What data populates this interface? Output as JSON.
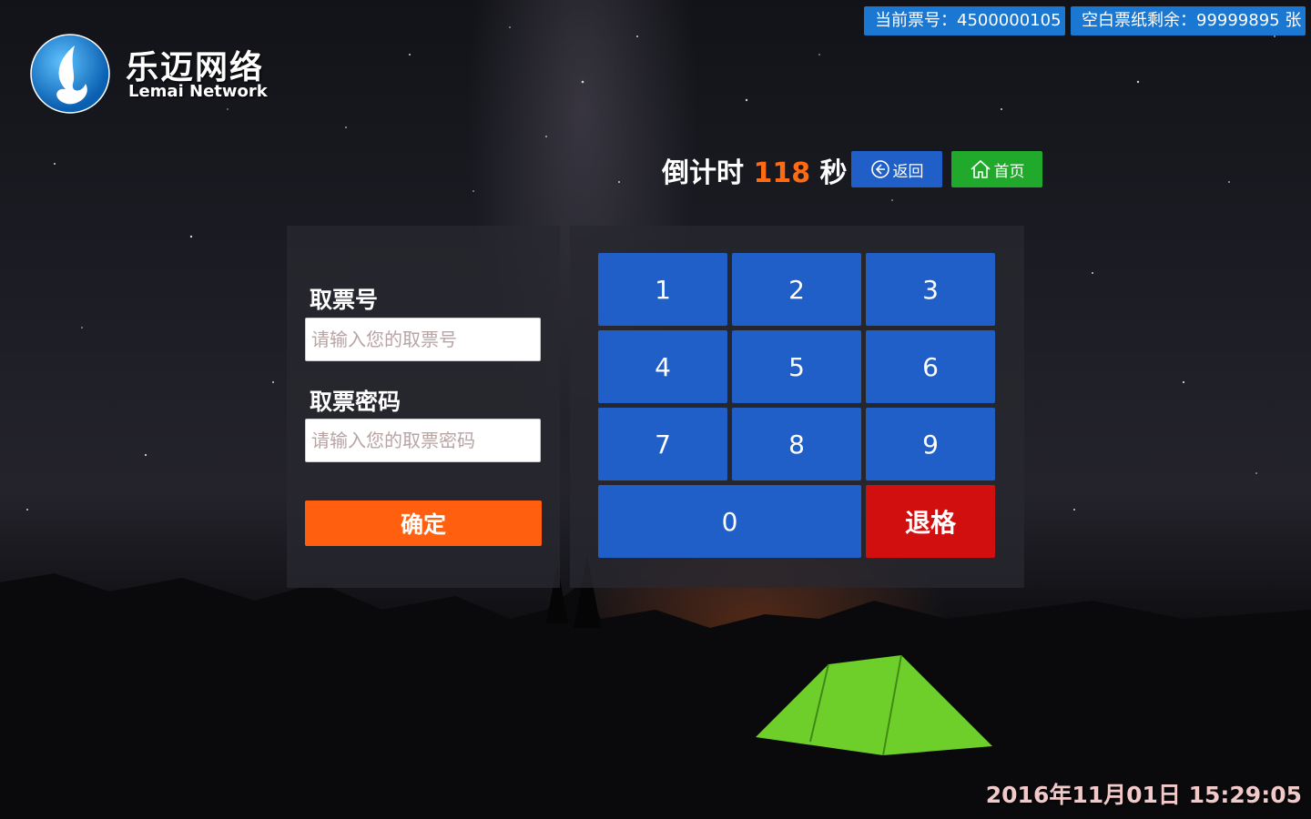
{
  "header": {
    "current_ticket": "当前票号：4500000105",
    "paper_remaining": "空白票纸剩余：99999895 张"
  },
  "logo": {
    "name_cn": "乐迈网络",
    "name_en": "Lemai Network"
  },
  "countdown": {
    "prefix": "倒计时",
    "seconds": "118",
    "suffix": "秒"
  },
  "nav": {
    "back_label": "返回",
    "home_label": "首页"
  },
  "form": {
    "ticket_no_label": "取票号",
    "ticket_no_placeholder": "请输入您的取票号",
    "ticket_no_value": "",
    "password_label": "取票密码",
    "password_placeholder": "请输入您的取票密码",
    "password_value": "",
    "confirm_label": "确定"
  },
  "keypad": {
    "keys": [
      "1",
      "2",
      "3",
      "4",
      "5",
      "6",
      "7",
      "8",
      "9",
      "0"
    ],
    "backspace_label": "退格"
  },
  "clock": "2016年11月01日 15:29:05",
  "colors": {
    "badge_blue": "#1a77d2",
    "key_blue": "#1f5fc7",
    "home_green": "#21a92c",
    "confirm_orange": "#ff5f0e",
    "backspace_red": "#d10f0f",
    "countdown_orange": "#ff6a13"
  },
  "icons": {
    "back": "arrow-left-circle-icon",
    "home": "house-icon",
    "logo": "lemai-logo-icon"
  }
}
